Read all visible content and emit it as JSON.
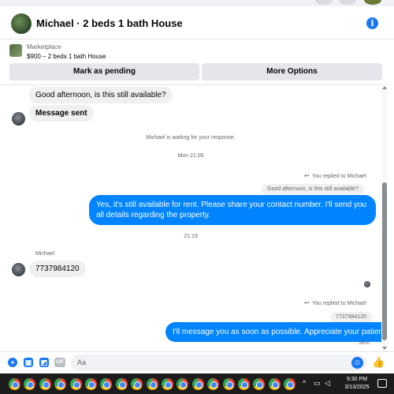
{
  "header": {
    "title": "Michael · 2 beds 1 bath House",
    "info_label": "i"
  },
  "listing": {
    "category": "Marketplace",
    "price_title": "$900 – 2 beds 1 bath House"
  },
  "actions": {
    "mark_pending": "Mark as pending",
    "more_options": "More Options"
  },
  "messages": {
    "in_1": "Good afternoon, is this still available?",
    "in_2": "Message sent",
    "waiting": "Michael is waiting for your response.",
    "time_1": "Mon 21:00",
    "replied_1": "You replied to Michael",
    "quoted_1": "Good afternoon, is this still available?",
    "out_1": "Yes, it's still available for rent. Please share your contact number. I'll send you all details regarding the property.",
    "time_2": "21:19",
    "sender_name": "Michael",
    "in_3": "7737984120",
    "replied_2": "You replied to Michael",
    "quoted_2": "7737984120",
    "out_2": "I'll message you as soon as possible. Appreciate your patience",
    "status": "Sent"
  },
  "composer": {
    "placeholder": "Aa",
    "gif_label": "GIF"
  },
  "taskbar": {
    "time": "9:30 PM",
    "date": "3/13/2025",
    "app_count": 19
  },
  "colors": {
    "accent": "#1877f2",
    "outgoing_bubble": "#0084ff",
    "incoming_bubble": "#f0f0f0"
  }
}
